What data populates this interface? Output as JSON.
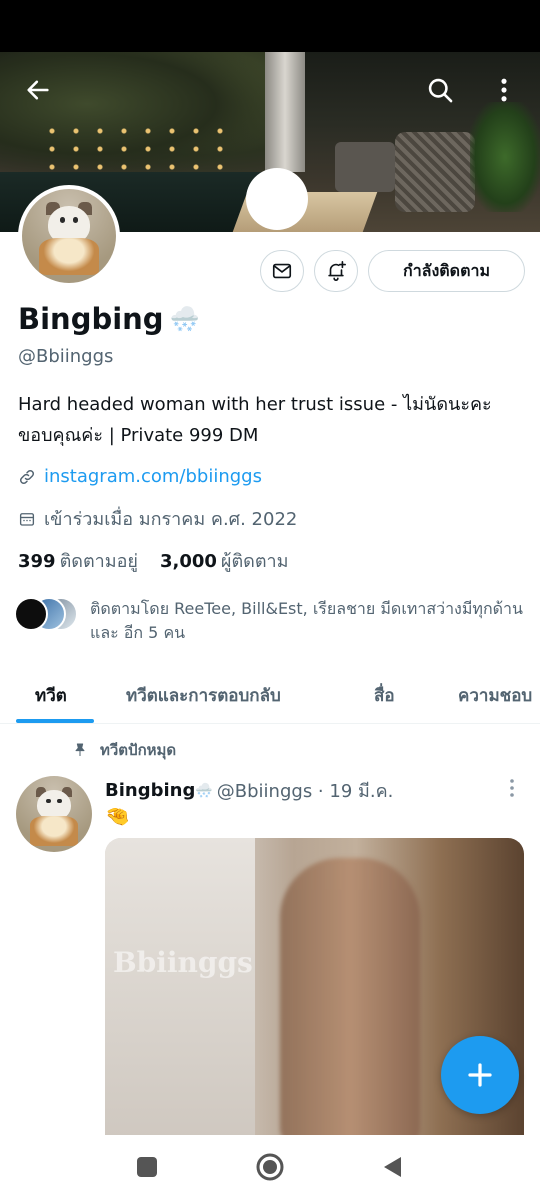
{
  "header": {
    "back_icon": "arrow-left-icon",
    "search_icon": "search-icon",
    "more_icon": "more-vertical-icon"
  },
  "profile": {
    "name": "Bingbing",
    "name_emoji": "🌨️",
    "handle": "@Bbiinggs",
    "bio": "Hard headed woman with her trust issue - ไม่นัดนะคะ ขอบคุณค่ะ | Private 999 DM",
    "website": "instagram.com/bbiinggs",
    "joined": "เข้าร่วมเมื่อ มกราคม ค.ศ. 2022",
    "following_count": "399",
    "following_label": "ติดตามอยู่",
    "followers_count": "3,000",
    "followers_label": "ผู้ติดตาม",
    "followed_by": "ติดตามโดย ReeTee, Bill&Est, เรียลชาย มีดเทาสว่างมีทุกด้าน และ อีก 5 คน"
  },
  "actions": {
    "message_icon": "mail-icon",
    "notify_icon": "bell-plus-icon",
    "following_label": "กำลังติดตาม"
  },
  "tabs": [
    {
      "label": "ทวีต",
      "active": true
    },
    {
      "label": "ทวีตและการตอบกลับ",
      "active": false
    },
    {
      "label": "สื่อ",
      "active": false
    },
    {
      "label": "ความชอบ",
      "active": false
    }
  ],
  "pinned": {
    "label": "ทวีตปักหมุด",
    "icon": "pin-icon"
  },
  "tweet": {
    "name": "Bingbing",
    "name_emoji": "🌨️",
    "meta": "@Bbiinggs · 19 มี.ค.",
    "text": "🤏",
    "media_watermark": "Bbiinggs"
  },
  "colors": {
    "accent": "#1d9bf0",
    "text_primary": "#0f1419",
    "text_secondary": "#536471",
    "border": "#cfd9de"
  },
  "nav": {
    "recents_icon": "square-icon",
    "home_icon": "circle-home-icon",
    "back_icon": "triangle-back-icon"
  }
}
